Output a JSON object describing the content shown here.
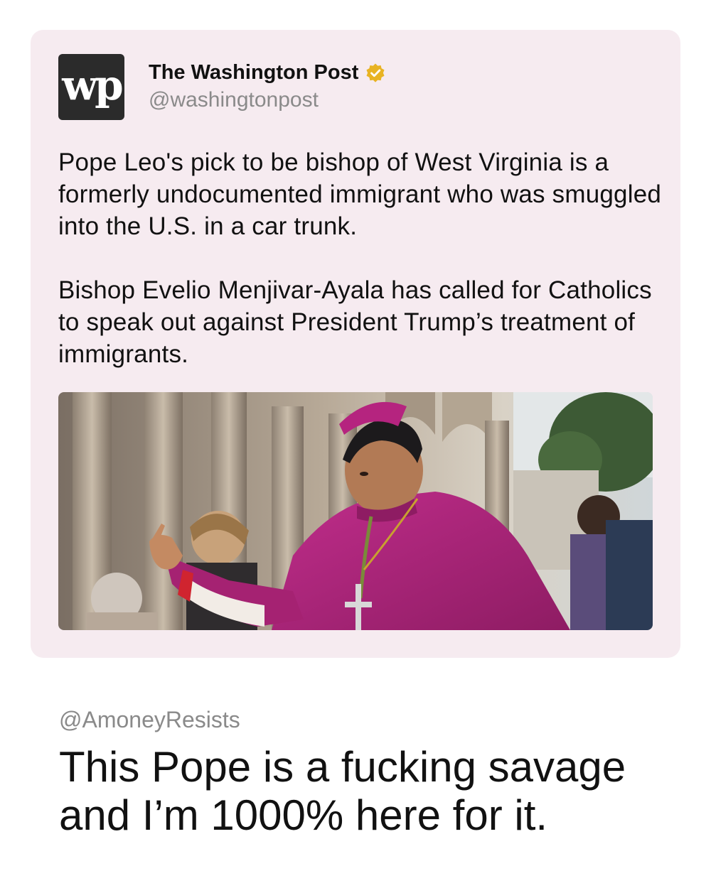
{
  "quoted_post": {
    "account_name": "The Washington Post",
    "handle": "@washingtonpost",
    "logo_text": "wp",
    "verified_icon": "verified-badge-icon",
    "paragraphs": [
      "Pope Leo's pick to be bishop of West Virginia is a formerly undocumented immigrant who was smuggled into the U.S. in a car trunk.",
      "Bishop Evelio Menjivar-Ayala has called for Catholics to speak out against President Trump’s treatment of immigrants."
    ],
    "image_subject": "Bishop in magenta vestments with pectoral cross, crowd and cathedral columns behind"
  },
  "reply": {
    "handle": "@AmoneyResists",
    "text": "This Pope is a fucking savage and I’m 1000% here for it."
  },
  "colors": {
    "card_background": "#f6ebf0",
    "verified_gold": "#e8b323",
    "handle_gray": "#8a8a8a",
    "vestment_magenta": "#b5247f"
  }
}
